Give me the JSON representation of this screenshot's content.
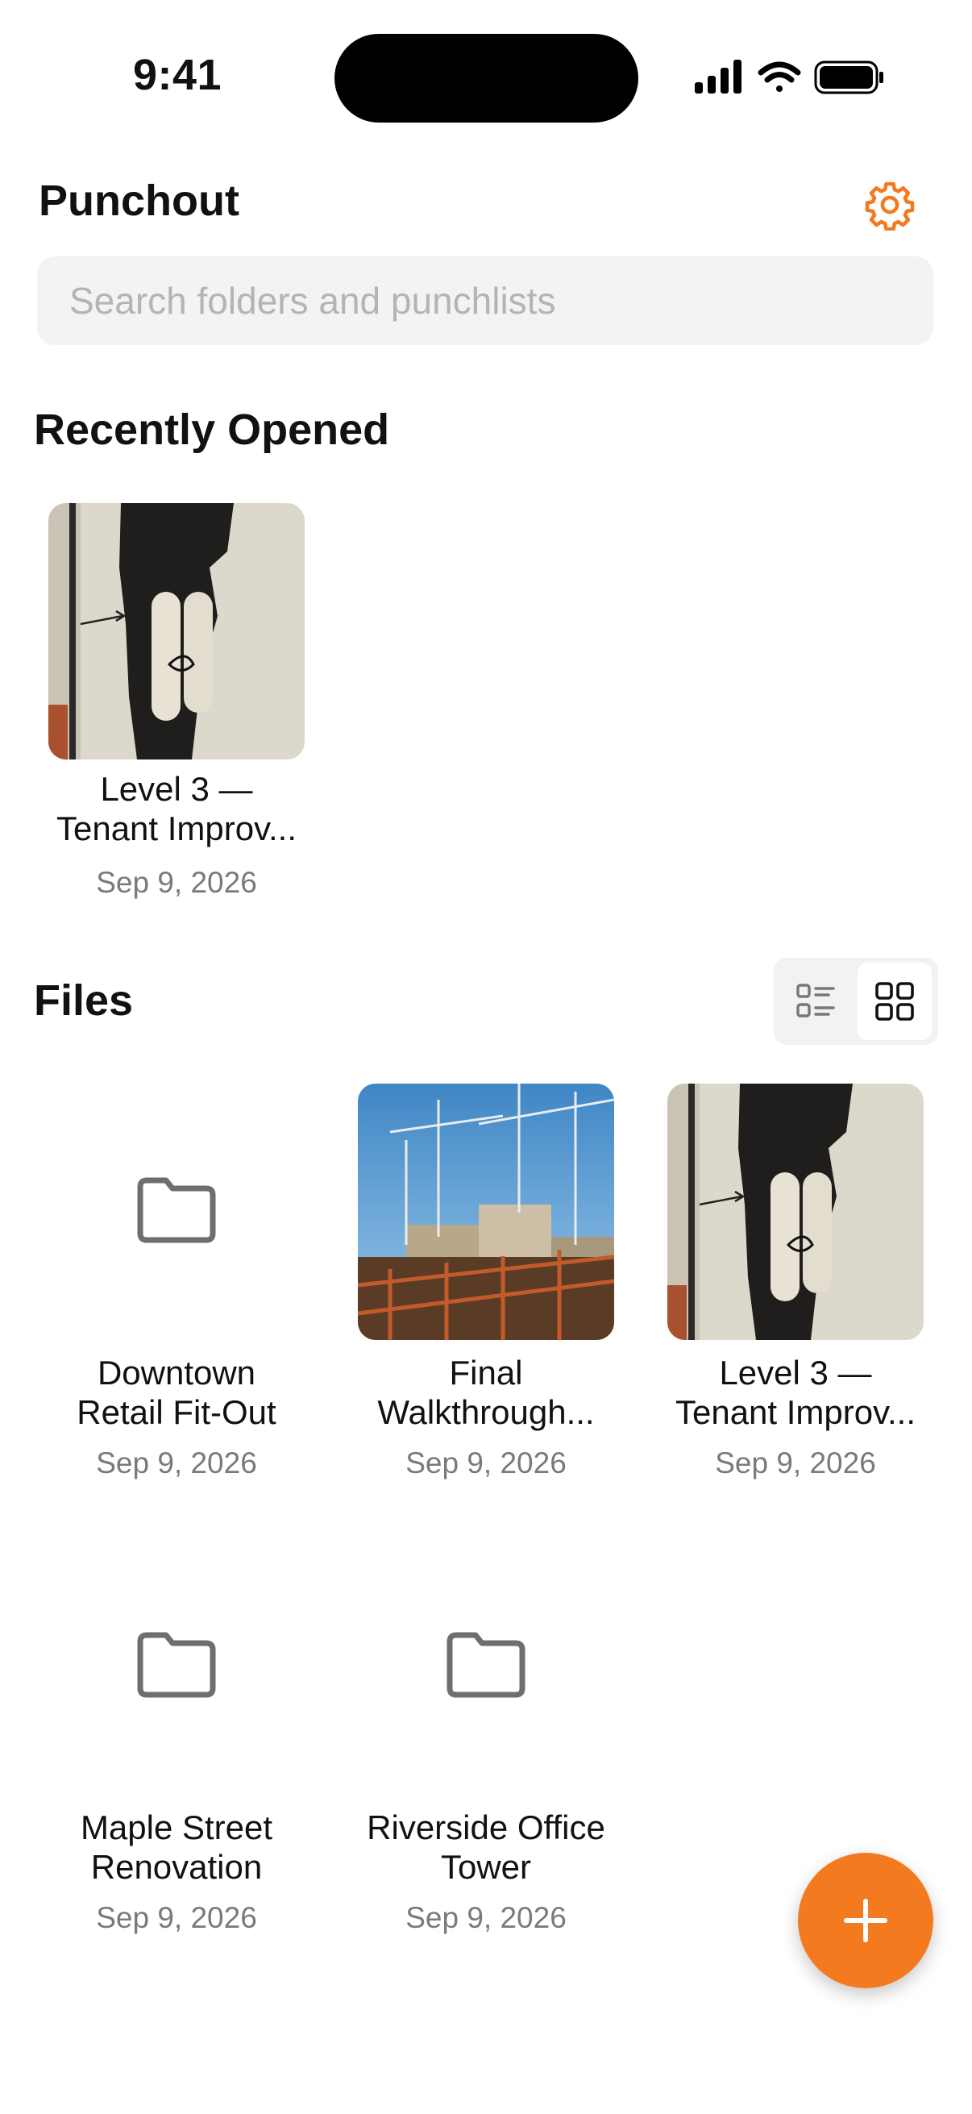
{
  "status_bar": {
    "time": "9:41"
  },
  "header": {
    "title": "Punchout",
    "settings_icon": "gear-icon",
    "accent_color": "#f47a20"
  },
  "search": {
    "placeholder": "Search folders and punchlists",
    "value": ""
  },
  "recent": {
    "title": "Recently Opened",
    "items": [
      {
        "name_line1": "Level 3 —",
        "name_line2": "Tenant Improv...",
        "date": "Sep 9, 2026",
        "kind": "photo"
      }
    ]
  },
  "files": {
    "title": "Files",
    "view_mode": "grid",
    "view_options": [
      "list",
      "grid"
    ],
    "items": [
      {
        "name_line1": "Downtown",
        "name_line2": "Retail Fit-Out",
        "date": "Sep 9, 2026",
        "kind": "folder"
      },
      {
        "name_line1": "Final",
        "name_line2": "Walkthrough...",
        "date": "Sep 9, 2026",
        "kind": "photo"
      },
      {
        "name_line1": "Level 3 —",
        "name_line2": "Tenant Improv...",
        "date": "Sep 9, 2026",
        "kind": "photo"
      },
      {
        "name_line1": "Maple Street",
        "name_line2": "Renovation",
        "date": "Sep 9, 2026",
        "kind": "folder"
      },
      {
        "name_line1": "Riverside Office",
        "name_line2": "Tower",
        "date": "Sep 9, 2026",
        "kind": "folder"
      }
    ]
  },
  "fab": {
    "icon": "plus-icon",
    "color": "#f47a20"
  }
}
